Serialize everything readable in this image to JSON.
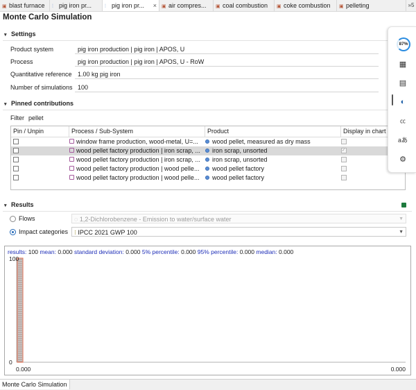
{
  "tabs": [
    {
      "label": "blast furnace",
      "icon": "process"
    },
    {
      "label": "pig iron pr...",
      "icon": "tree"
    },
    {
      "label": "pig iron pr...",
      "icon": "tree",
      "active": true,
      "close": "×"
    },
    {
      "label": "air compres...",
      "icon": "process"
    },
    {
      "label": "coal combustion",
      "icon": "process"
    },
    {
      "label": "coke combustion",
      "icon": "process"
    },
    {
      "label": "pelleting",
      "icon": "process"
    }
  ],
  "tab_overflow": "»5",
  "page_title": "Monte Carlo Simulation",
  "settings": {
    "header": "Settings",
    "product_system_label": "Product system",
    "product_system_value": "pig iron production | pig iron | APOS, U",
    "process_label": "Process",
    "process_value": "pig iron production | pig iron | APOS, U - RoW",
    "quant_ref_label": "Quantitative reference",
    "quant_ref_value": "1.00 kg pig iron",
    "num_sim_label": "Number of simulations",
    "num_sim_value": "100"
  },
  "pinned": {
    "header": "Pinned contributions",
    "filter_label": "Filter",
    "filter_value": "pellet",
    "columns": [
      "Pin / Unpin",
      "Process / Sub-System",
      "Product",
      "Display in chart"
    ],
    "rows": [
      {
        "process": "window frame production, wood-metal, U=...",
        "product": "wood pellet, measured as dry mass",
        "display_checked": false,
        "selected": false
      },
      {
        "process": "wood pellet factory production | iron scrap, ...",
        "product": "iron scrap, unsorted",
        "display_checked": true,
        "selected": true
      },
      {
        "process": "wood pellet factory production | iron scrap, ...",
        "product": "iron scrap, unsorted",
        "display_checked": false,
        "selected": false
      },
      {
        "process": "wood pellet factory production | wood pelle...",
        "product": "wood pellet factory",
        "display_checked": false,
        "selected": false
      },
      {
        "process": "wood pellet factory production | wood pelle...",
        "product": "wood pellet factory",
        "display_checked": false,
        "selected": false
      }
    ]
  },
  "results": {
    "header": "Results",
    "flows_label": "Flows",
    "flows_value": "1,2-Dichlorobenzene - Emission to water/surface water",
    "impact_label": "Impact categories",
    "impact_value": "IPCC 2021 GWP 100",
    "selected": "impact"
  },
  "stats": {
    "results_label": "results:",
    "results_value": "100",
    "mean_label": "mean:",
    "mean_value": "0.000",
    "sd_label": "standard deviation:",
    "sd_value": "0.000",
    "p5_label": "5% percentile:",
    "p5_value": "0.000",
    "p95_label": "95% percentile:",
    "p95_value": "0.000",
    "median_label": "median:",
    "median_value": "0.000"
  },
  "chart_data": {
    "type": "bar",
    "x": [
      0.0
    ],
    "values": [
      100
    ],
    "ylim": [
      0,
      100
    ],
    "ytick_labels": [
      "0",
      "100"
    ],
    "xtick_labels": [
      "0.000",
      "0.000"
    ]
  },
  "bottom_tab": "Monte Carlo Simulation",
  "sidebar": {
    "gauge_value": "87%",
    "icons": [
      "copilot-gauge-icon",
      "chip-icon",
      "note-icon",
      "edge-icon",
      "caption-icon",
      "translate-icon",
      "settings-icon"
    ]
  },
  "colors": {
    "accent": "#2067b8",
    "stats_key": "#1f2fb8",
    "bar": "#e06b4d",
    "excel": "#1e7a3e"
  }
}
